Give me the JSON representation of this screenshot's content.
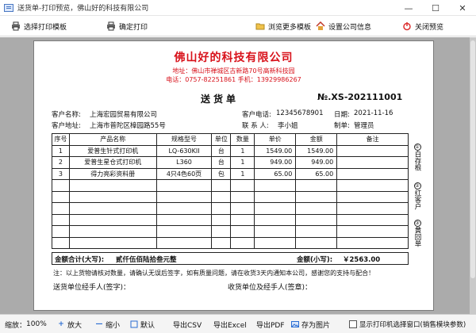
{
  "window": {
    "title": "送货单-打印预览，佛山好的科技有限公司",
    "minimize": "—",
    "maximize": "☐",
    "close": "✕"
  },
  "toolbar": {
    "select_template": "选择打印模板",
    "confirm_print": "确定打印",
    "browse_templates": "浏览更多模板",
    "company_info": "设置公司信息",
    "close_preview": "关闭预览"
  },
  "doc": {
    "company": "佛山好的科技有限公司",
    "address": "地址：佛山市禅城区古新路70号高新科技园",
    "phone": "电话：0757-82251861  手机：13929986267",
    "title": "送货单",
    "doc_no": "№.XS-202111001",
    "customer_name_label": "客户名称:",
    "customer_name": "上海宏园贸易有限公司",
    "customer_phone_label": "客户电话:",
    "customer_phone": "12345678901",
    "date_label": "日期:",
    "date": "2021-11-16",
    "customer_addr_label": "客户地址:",
    "customer_addr": "上海市普陀区樟园路55号",
    "contact_label": "联 系 人:",
    "contact": "李小姐",
    "maker_label": "制单:",
    "maker": "管理员",
    "columns": [
      "序号",
      "产品名称",
      "规格型号",
      "单位",
      "数量",
      "单价",
      "金额",
      "备注"
    ],
    "rows": [
      [
        "1",
        "爱普生针式打印机",
        "LQ-630KII",
        "台",
        "1",
        "1549.00",
        "1549.00",
        ""
      ],
      [
        "2",
        "爱普生星仓式打印机",
        "L360",
        "台",
        "1",
        "949.00",
        "949.00",
        ""
      ],
      [
        "3",
        "得力亮彩资料册",
        "4只4色60页",
        "包",
        "1",
        "65.00",
        "65.00",
        ""
      ]
    ],
    "side_copies": [
      {
        "n": "①",
        "text": "白存根"
      },
      {
        "n": "②",
        "text": "红客户"
      },
      {
        "n": "③",
        "text": "黄回单"
      }
    ],
    "total_upper_label": "金额合计(大写):",
    "total_upper": "贰仟伍佰陆拾叁元整",
    "total_lower_label": "金额(小写):",
    "total_lower": "￥2563.00",
    "note": "注：以上货物请核对数量，请确认无误后签字，如有质量问题，请在收货3天内通知本公司，感谢您的支持与配合！",
    "sender_sign": "送货单位经手人(签字)：",
    "receiver_sign": "收货单位及经手人(签章)："
  },
  "statusbar": {
    "zoom_label": "缩放：",
    "zoom": "100%",
    "zoom_in": "放大",
    "zoom_out": "缩小",
    "default": "默认",
    "export_csv": "导出CSV",
    "export_excel": "导出Excel",
    "export_pdf": "导出PDF",
    "save_image": "存为图片",
    "show_select_window": "显示打印机选择窗口(销售模块参数)"
  }
}
